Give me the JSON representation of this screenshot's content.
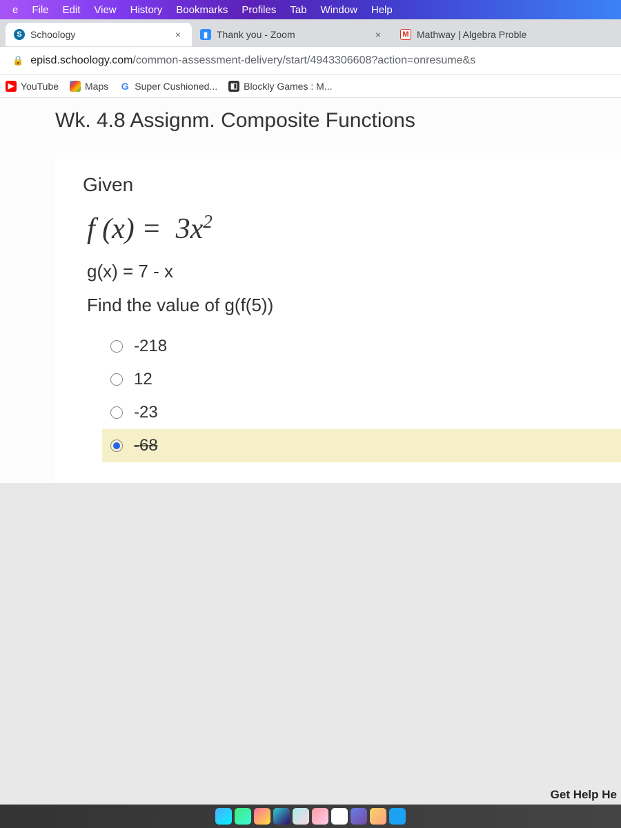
{
  "menubar": {
    "items": [
      "e",
      "File",
      "Edit",
      "View",
      "History",
      "Bookmarks",
      "Profiles",
      "Tab",
      "Window",
      "Help"
    ]
  },
  "tabs": [
    {
      "title": "Schoology",
      "favicon": "S",
      "active": true
    },
    {
      "title": "Thank you - Zoom",
      "favicon": "▮",
      "active": false
    },
    {
      "title": "Mathway | Algebra Proble",
      "favicon": "M",
      "active": false
    }
  ],
  "address": {
    "host": "episd.schoology.com",
    "path": "/common-assessment-delivery/start/4943306608?action=onresume&s"
  },
  "bookmarks": [
    {
      "label": "YouTube",
      "iconClass": "yt",
      "glyph": "▶"
    },
    {
      "label": "Maps",
      "iconClass": "maps",
      "glyph": ""
    },
    {
      "label": "Super Cushioned...",
      "iconClass": "google",
      "glyph": "G"
    },
    {
      "label": "Blockly Games : M...",
      "iconClass": "blockly",
      "glyph": "◧"
    }
  ],
  "page": {
    "title": "Wk. 4.8 Assignm. Composite Functions",
    "given_label": "Given",
    "formula_html": "f (x) = &nbsp;3x<span class='sup'>2</span>",
    "gx": "g(x) = 7 - x",
    "find": "Find the value of g(f(5))",
    "options": [
      {
        "label": "-218",
        "selected": false
      },
      {
        "label": "12",
        "selected": false
      },
      {
        "label": "-23",
        "selected": false
      },
      {
        "label": "-68",
        "selected": true,
        "strike": true
      }
    ]
  },
  "footer": {
    "help_label": "Get Help He"
  },
  "close_glyph": "×"
}
